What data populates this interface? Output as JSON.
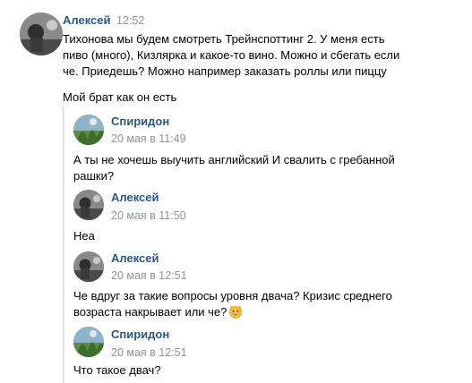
{
  "message": {
    "author": "Алексей",
    "time": "12:52",
    "lines": [
      "Тихонова мы будем смотреть Трейнспоттинг 2. У меня есть",
      "пиво (много), Кизлярка и какое-то вино. Можно и сбегать если",
      "че. Приедешь? Можно например заказать роллы или пиццу"
    ],
    "second_paragraph": "Мой брат как он есть"
  },
  "forwarded": [
    {
      "author": "Спиридон",
      "date": "20 мая в 11:49",
      "lines": [
        "А ты не хочешь выучить английский И свалить с гребанной",
        "рашки?"
      ],
      "avatar_icon": "avatar-plant-icon"
    },
    {
      "author": "Алексей",
      "date": "20 мая в 11:50",
      "lines": [
        "Неа"
      ],
      "avatar_icon": "avatar-bw-photo-icon"
    },
    {
      "author": "Алексей",
      "date": "20 мая в 12:51",
      "lines": [
        "Че вдруг за такие вопросы уровня двача? Кризис среднего",
        "возраста накрывает или че?"
      ],
      "emoji": "grinning-cat-emoji-icon",
      "avatar_icon": "avatar-bw-photo-icon"
    },
    {
      "author": "Спиридон",
      "date": "20 мая в 12:51",
      "lines": [
        "Что такое двач?"
      ],
      "avatar_icon": "avatar-plant-icon"
    }
  ],
  "colors": {
    "author_link": "#2a5885",
    "timestamp": "#939393",
    "forward_bar": "#dae1e8",
    "text": "#000000"
  }
}
